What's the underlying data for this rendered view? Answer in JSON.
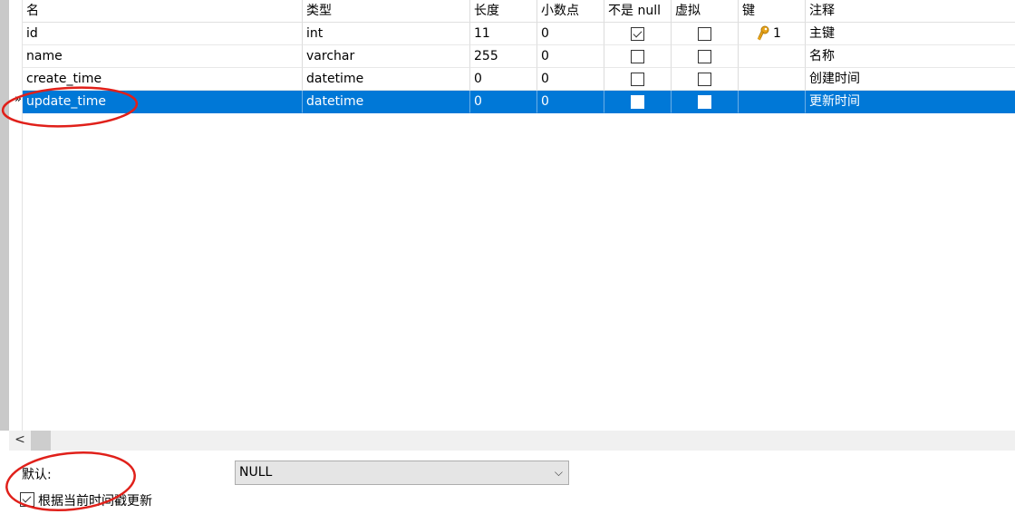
{
  "columns": {
    "name": "名",
    "type": "类型",
    "length": "长度",
    "decimals": "小数点",
    "not_null": "不是 null",
    "virtual": "虚拟",
    "key": "键",
    "comment": "注释"
  },
  "rows": [
    {
      "name": "id",
      "type": "int",
      "length": "11",
      "decimals": "0",
      "not_null": true,
      "virtual": false,
      "key": "1",
      "comment": "主键"
    },
    {
      "name": "name",
      "type": "varchar",
      "length": "255",
      "decimals": "0",
      "not_null": false,
      "virtual": false,
      "key": "",
      "comment": "名称"
    },
    {
      "name": "create_time",
      "type": "datetime",
      "length": "0",
      "decimals": "0",
      "not_null": false,
      "virtual": false,
      "key": "",
      "comment": "创建时间"
    },
    {
      "name": "update_time",
      "type": "datetime",
      "length": "0",
      "decimals": "0",
      "not_null": false,
      "virtual": false,
      "key": "",
      "comment": "更新时间",
      "selected": true
    }
  ],
  "row_marker": "»",
  "scroll_left_glyph": "<",
  "properties": {
    "default_label": "默认:",
    "default_value": "NULL",
    "chevron": "⌵",
    "on_update_label": "根据当前时间戳更新",
    "on_update_checked": true
  },
  "colors": {
    "selection": "#0078d7",
    "annotation": "#e0201a",
    "key_icon": "#e8a317"
  },
  "icons": {
    "key": "key-icon",
    "checkbox": "checkbox-icon"
  }
}
